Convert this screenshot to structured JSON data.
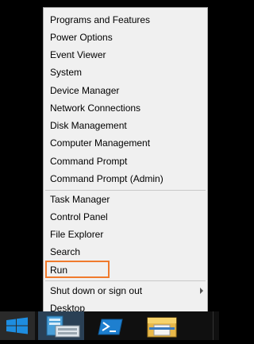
{
  "context_menu": {
    "items": [
      "Programs and Features",
      "Power Options",
      "Event Viewer",
      "System",
      "Device Manager",
      "Network Connections",
      "Disk Management",
      "Computer Management",
      "Command Prompt",
      "Command Prompt (Admin)",
      "Task Manager",
      "Control Panel",
      "File Explorer",
      "Search",
      "Run",
      "Shut down or sign out",
      "Desktop"
    ],
    "highlight_color": "#f07a2d"
  },
  "taskbar": {
    "icons": [
      "windows-start-icon",
      "server-manager-icon",
      "powershell-icon",
      "file-explorer-icon"
    ]
  }
}
